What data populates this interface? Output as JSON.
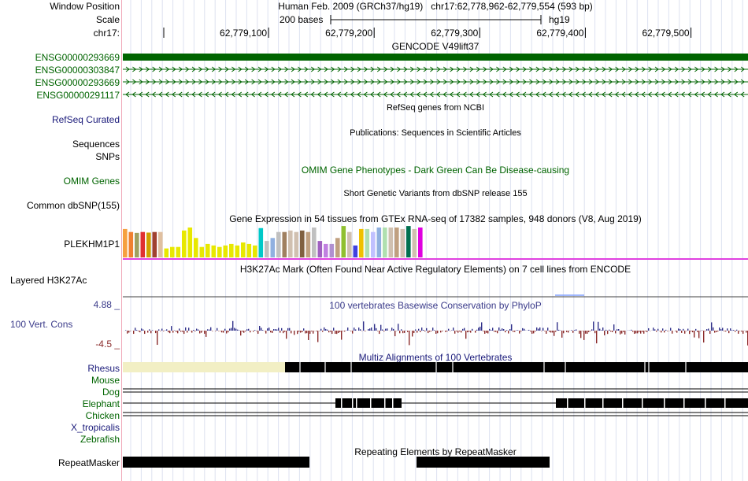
{
  "header": {
    "window_position_label": "Window Position",
    "scale_label": "Scale",
    "chrom_label": "chr17:",
    "position_text": "Human Feb. 2009 (GRCh37/hg19)   chr17:62,778,962-62,779,554 (593 bp)",
    "scale_text": "200 bases",
    "assembly": "hg19",
    "ticks": [
      {
        "label": "62,779,100",
        "pos": 62779100
      },
      {
        "label": "62,779,200",
        "pos": 62779200
      },
      {
        "label": "62,779,300",
        "pos": 62779300
      },
      {
        "label": "62,779,400",
        "pos": 62779400
      },
      {
        "label": "62,779,500",
        "pos": 62779500
      }
    ]
  },
  "view": {
    "start": 62778962,
    "end": 62779554
  },
  "gencode": {
    "title": "GENCODE V49lift37",
    "color": "#006400",
    "genes": [
      {
        "name": "ENSG00000293669",
        "style": "block"
      },
      {
        "name": "ENSG00000303847",
        "style": "arrows-right"
      },
      {
        "name": "ENSG00000293669",
        "style": "arrows-right"
      },
      {
        "name": "ENSG00000291117",
        "style": "arrows-left"
      }
    ]
  },
  "refseq": {
    "title": "RefSeq genes from NCBI",
    "label": "RefSeq Curated"
  },
  "publications": {
    "title": "Publications: Sequences in Scientific Articles",
    "labels": [
      "Sequences",
      "SNPs"
    ]
  },
  "omim": {
    "title": "OMIM Gene Phenotypes - Dark Green Can Be Disease-causing",
    "label": "OMIM Genes"
  },
  "dbsnp": {
    "title": "Short Genetic Variants from dbSNP release 155",
    "label": "Common dbSNP(155)"
  },
  "gtex": {
    "title": "Gene Expression in 54 tissues from GTEx RNA-seq of 17382 samples, 948 donors (V8, Aug 2019)",
    "label": "PLEKHM1P1",
    "bars": [
      {
        "color": "#f6a040",
        "value": 0.95
      },
      {
        "color": "#f08030",
        "value": 0.85
      },
      {
        "color": "#a0a060",
        "value": 0.82
      },
      {
        "color": "#e03030",
        "value": 0.85
      },
      {
        "color": "#d0a000",
        "value": 0.83
      },
      {
        "color": "#a04030",
        "value": 0.85
      },
      {
        "color": "#e0c0a0",
        "value": 0.85
      },
      {
        "color": "#e8e800",
        "value": 0.3
      },
      {
        "color": "#e8e800",
        "value": 0.35
      },
      {
        "color": "#e8e800",
        "value": 0.35
      },
      {
        "color": "#e8e800",
        "value": 0.9
      },
      {
        "color": "#e8e800",
        "value": 1.0
      },
      {
        "color": "#e8e800",
        "value": 0.65
      },
      {
        "color": "#e8e800",
        "value": 0.35
      },
      {
        "color": "#e8e800",
        "value": 0.45
      },
      {
        "color": "#e8e800",
        "value": 0.4
      },
      {
        "color": "#e8e800",
        "value": 0.35
      },
      {
        "color": "#e8e800",
        "value": 0.4
      },
      {
        "color": "#e8e800",
        "value": 0.45
      },
      {
        "color": "#e8e800",
        "value": 0.4
      },
      {
        "color": "#e8e800",
        "value": 0.5
      },
      {
        "color": "#e8e800",
        "value": 0.45
      },
      {
        "color": "#e8e800",
        "value": 0.4
      },
      {
        "color": "#00c8c8",
        "value": 0.98
      },
      {
        "color": "#c0c0c0",
        "value": 0.55
      },
      {
        "color": "#90b0e0",
        "value": 0.65
      },
      {
        "color": "#c0c0c0",
        "value": 0.85
      },
      {
        "color": "#a08060",
        "value": 0.85
      },
      {
        "color": "#d0c0b0",
        "value": 0.9
      },
      {
        "color": "#d0c0b0",
        "value": 0.85
      },
      {
        "color": "#806040",
        "value": 0.9
      },
      {
        "color": "#c0a080",
        "value": 0.85
      },
      {
        "color": "#c0c0c0",
        "value": 1.0
      },
      {
        "color": "#a060c0",
        "value": 0.55
      },
      {
        "color": "#c080e0",
        "value": 0.45
      },
      {
        "color": "#b090d0",
        "value": 0.45
      },
      {
        "color": "#c0a080",
        "value": 0.65
      },
      {
        "color": "#90c030",
        "value": 1.05
      },
      {
        "color": "#d0c0b0",
        "value": 0.85
      },
      {
        "color": "#4040e0",
        "value": 0.4
      },
      {
        "color": "#f0c000",
        "value": 0.95
      },
      {
        "color": "#b0e0b0",
        "value": 0.95
      },
      {
        "color": "#c0c0ff",
        "value": 0.85
      },
      {
        "color": "#90b0e0",
        "value": 1.0
      },
      {
        "color": "#b0e0b0",
        "value": 1.0
      },
      {
        "color": "#d0c0b0",
        "value": 1.0
      },
      {
        "color": "#c0a080",
        "value": 1.0
      },
      {
        "color": "#d0c0b0",
        "value": 0.95
      },
      {
        "color": "#007050",
        "value": 1.05
      },
      {
        "color": "#d0c0b0",
        "value": 0.95
      },
      {
        "color": "#e000e0",
        "value": 1.0
      }
    ]
  },
  "h3k27ac": {
    "title": "H3K27Ac Mark (Often Found Near Active Regulatory Elements) on 7 cell lines from ENCODE",
    "label": "Layered H3K27Ac"
  },
  "conservation": {
    "title": "100 vertebrates Basewise Conservation by PhyloP",
    "label": "100 Vert. Cons",
    "max_label": "4.88 _",
    "min_label": "-4.5 _",
    "ymax": 4.88,
    "ymin": -4.5,
    "pos_color": "#30308a",
    "neg_color": "#8a2a2a"
  },
  "multiz": {
    "title": "Multiz Alignments of 100 Vertebrates",
    "species": [
      {
        "name": "Rhesus",
        "color": "#1a1a7a"
      },
      {
        "name": "Mouse",
        "color": "#006400"
      },
      {
        "name": "Dog",
        "color": "#006400"
      },
      {
        "name": "Elephant",
        "color": "#006400"
      },
      {
        "name": "Chicken",
        "color": "#006400"
      },
      {
        "name": "X_tropicalis",
        "color": "#1a1a7a"
      },
      {
        "name": "Zebrafish",
        "color": "#006400"
      }
    ]
  },
  "repeatmasker": {
    "title": "Repeating Elements by RepeatMasker",
    "label": "RepeatMasker"
  }
}
